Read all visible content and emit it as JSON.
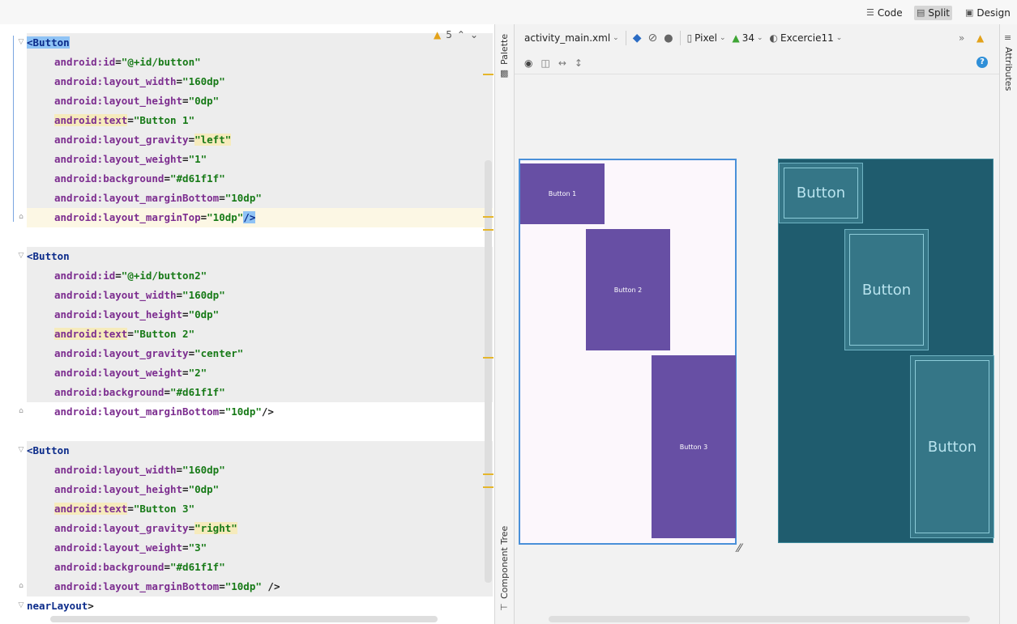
{
  "view_modes": [
    {
      "icon": "hamburger-icon",
      "label": "Code"
    },
    {
      "icon": "split-icon",
      "label": "Split"
    },
    {
      "icon": "image-icon",
      "label": "Design"
    }
  ],
  "editor": {
    "warnings": {
      "count": "5"
    },
    "lines": [
      {
        "parts": [
          [
            "tag",
            "<Button"
          ]
        ]
      },
      {
        "parts": [
          [
            "attr",
            "android:id"
          ],
          [
            "punct",
            "="
          ],
          [
            "val",
            "\"@+id/button\""
          ]
        ]
      },
      {
        "parts": [
          [
            "attr",
            "android:layout_width"
          ],
          [
            "punct",
            "="
          ],
          [
            "val",
            "\"160dp\""
          ]
        ]
      },
      {
        "parts": [
          [
            "attr",
            "android:layout_height"
          ],
          [
            "punct",
            "="
          ],
          [
            "val",
            "\"0dp\""
          ]
        ]
      },
      {
        "parts": [
          [
            "attr",
            "android:text"
          ],
          [
            "punct",
            "="
          ],
          [
            "val",
            "\"Button 1\""
          ]
        ]
      },
      {
        "parts": [
          [
            "attr",
            "android:layout_gravity"
          ],
          [
            "punct",
            "="
          ],
          [
            "val",
            "\"left\""
          ]
        ]
      },
      {
        "parts": [
          [
            "attr",
            "android:layout_weight"
          ],
          [
            "punct",
            "="
          ],
          [
            "val",
            "\"1\""
          ]
        ]
      },
      {
        "parts": [
          [
            "attr",
            "android:background"
          ],
          [
            "punct",
            "="
          ],
          [
            "val",
            "\"#d61f1f\""
          ]
        ]
      },
      {
        "parts": [
          [
            "attr",
            "android:layout_marginBottom"
          ],
          [
            "punct",
            "="
          ],
          [
            "val",
            "\"10dp\""
          ]
        ]
      },
      {
        "parts": [
          [
            "attr",
            "android:layout_marginTop"
          ],
          [
            "punct",
            "="
          ],
          [
            "val",
            "\"10dp\""
          ],
          [
            "tag",
            "/>"
          ]
        ]
      },
      {
        "parts": []
      },
      {
        "parts": [
          [
            "tag",
            "<Button"
          ]
        ]
      },
      {
        "parts": [
          [
            "attr",
            "android:id"
          ],
          [
            "punct",
            "="
          ],
          [
            "val",
            "\"@+id/button2\""
          ]
        ]
      },
      {
        "parts": [
          [
            "attr",
            "android:layout_width"
          ],
          [
            "punct",
            "="
          ],
          [
            "val",
            "\"160dp\""
          ]
        ]
      },
      {
        "parts": [
          [
            "attr",
            "android:layout_height"
          ],
          [
            "punct",
            "="
          ],
          [
            "val",
            "\"0dp\""
          ]
        ]
      },
      {
        "parts": [
          [
            "attr",
            "android:text"
          ],
          [
            "punct",
            "="
          ],
          [
            "val",
            "\"Button 2\""
          ]
        ]
      },
      {
        "parts": [
          [
            "attr",
            "android:layout_gravity"
          ],
          [
            "punct",
            "="
          ],
          [
            "val",
            "\"center\""
          ]
        ]
      },
      {
        "parts": [
          [
            "attr",
            "android:layout_weight"
          ],
          [
            "punct",
            "="
          ],
          [
            "val",
            "\"2\""
          ]
        ]
      },
      {
        "parts": [
          [
            "attr",
            "android:background"
          ],
          [
            "punct",
            "="
          ],
          [
            "val",
            "\"#d61f1f\""
          ]
        ]
      },
      {
        "parts": [
          [
            "attr",
            "android:layout_marginBottom"
          ],
          [
            "punct",
            "="
          ],
          [
            "val",
            "\"10dp\""
          ],
          [
            "punct",
            "/>"
          ]
        ]
      },
      {
        "parts": []
      },
      {
        "parts": [
          [
            "tag",
            "<Button"
          ]
        ]
      },
      {
        "parts": [
          [
            "attr",
            "android:layout_width"
          ],
          [
            "punct",
            "="
          ],
          [
            "val",
            "\"160dp\""
          ]
        ]
      },
      {
        "parts": [
          [
            "attr",
            "android:layout_height"
          ],
          [
            "punct",
            "="
          ],
          [
            "val",
            "\"0dp\""
          ]
        ]
      },
      {
        "parts": [
          [
            "attr",
            "android:text"
          ],
          [
            "punct",
            "="
          ],
          [
            "val",
            "\"Button 3\""
          ]
        ]
      },
      {
        "parts": [
          [
            "attr",
            "android:layout_gravity"
          ],
          [
            "punct",
            "="
          ],
          [
            "val",
            "\"right\""
          ]
        ]
      },
      {
        "parts": [
          [
            "attr",
            "android:layout_weight"
          ],
          [
            "punct",
            "="
          ],
          [
            "val",
            "\"3\""
          ]
        ]
      },
      {
        "parts": [
          [
            "attr",
            "android:background"
          ],
          [
            "punct",
            "="
          ],
          [
            "val",
            "\"#d61f1f\""
          ]
        ]
      },
      {
        "parts": [
          [
            "attr",
            "android:layout_marginBottom"
          ],
          [
            "punct",
            "="
          ],
          [
            "val",
            "\"10dp\""
          ],
          [
            "punct",
            " />"
          ]
        ]
      },
      {
        "parts": [
          [
            "tag",
            "nearLayout"
          ],
          [
            "punct",
            ">"
          ]
        ]
      }
    ]
  },
  "side_panels": {
    "palette": "Palette",
    "component_tree": "Component Tree",
    "attributes": "Attributes"
  },
  "design_toolbar": {
    "file": "activity_main.xml",
    "device": "Pixel",
    "api": "34",
    "theme": "Excercie11"
  },
  "preview": {
    "buttons": [
      "Button 1",
      "Button 2",
      "Button 3"
    ],
    "button_color": "#674fa4"
  },
  "blueprint": {
    "buttons": [
      "Button",
      "Button",
      "Button"
    ]
  }
}
